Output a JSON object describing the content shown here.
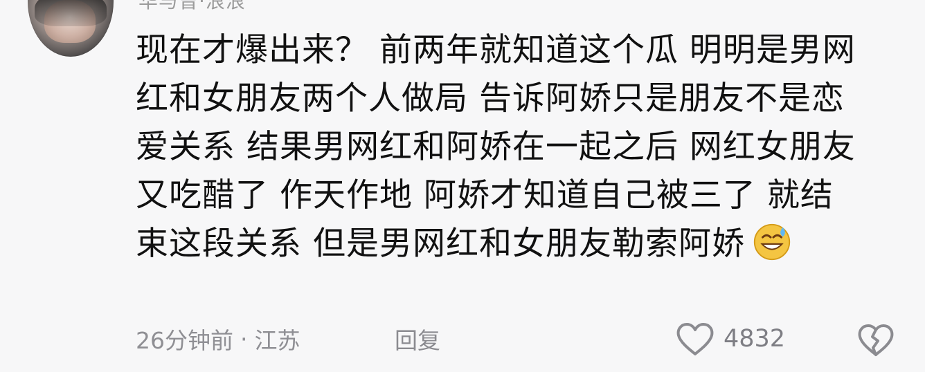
{
  "comment": {
    "username": "华与曾·浪浪",
    "lines": [
      "现在才爆出来？ 前两年就知道这个瓜 明明是男网",
      "红和女朋友两个人做局 告诉阿娇只是朋友不是恋",
      "爱关系 结果男网红和阿娇在一起之后 网红女朋友",
      "又吃醋了 作天作地 阿娇才知道自己被三了 就结",
      "束这段关系 但是男网红和女朋友勒索阿娇"
    ],
    "emoji_icon": "sweat-smile-icon",
    "time": "26分钟前",
    "separator": "·",
    "location": "江苏",
    "reply_label": "回复",
    "likes": "4832",
    "like_icon": "heart-icon",
    "dislike_icon": "broken-heart-icon"
  },
  "colors": {
    "background": "#f7f7f8",
    "text": "#111111",
    "meta": "#8f8f94",
    "icon": "#7e7e84",
    "emoji": "#f4c542"
  }
}
